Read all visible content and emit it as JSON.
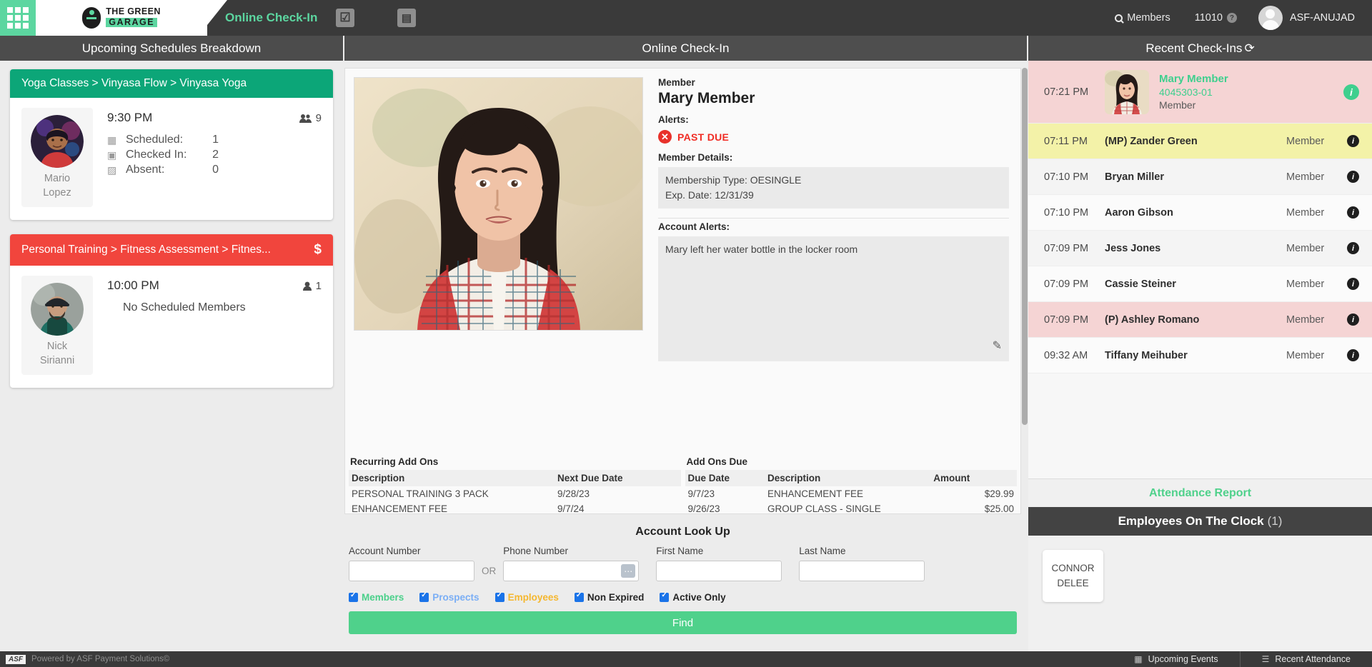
{
  "topbar": {
    "grid_icon": "grid-apps-icon",
    "logo_line1": "THE GREEN",
    "logo_line2": "GARAGE",
    "page_title": "Online Check-In",
    "check_icon": "☑",
    "card_icon": "▣",
    "members_label": "Members",
    "store_number": "11010",
    "help_icon": "?",
    "user_name": "ASF-ANUJAD"
  },
  "headers": {
    "left": "Upcoming Schedules Breakdown",
    "center": "Online Check-In",
    "right": "Recent Check-Ins",
    "refresh_icon": "⟳"
  },
  "schedules": [
    {
      "title": "Yoga Classes > Vinyasa Flow > Vinyasa Yoga",
      "color": "teal",
      "badge": "",
      "trainer_first": "Mario",
      "trainer_last": "Lopez",
      "time": "9:30 PM",
      "capacity": "9",
      "capacity_icon": "group-icon",
      "stats": [
        {
          "icon": "calendar-icon",
          "label": "Scheduled:",
          "value": "1"
        },
        {
          "icon": "calendar-check-icon",
          "label": "Checked In:",
          "value": "2"
        },
        {
          "icon": "calendar-x-icon",
          "label": "Absent:",
          "value": "0"
        }
      ],
      "empty_text": ""
    },
    {
      "title": "Personal Training > Fitness Assessment > Fitnes...",
      "color": "red",
      "badge": "$",
      "trainer_first": "Nick",
      "trainer_last": "Sirianni",
      "time": "10:00 PM",
      "capacity": "1",
      "capacity_icon": "person-icon",
      "stats": [],
      "empty_text": "No Scheduled Members"
    }
  ],
  "member": {
    "section_label": "Member",
    "name": "Mary Member",
    "alerts_label": "Alerts:",
    "alert_text": "PAST DUE",
    "alert_icon": "x-circle-icon",
    "details_label": "Member Details:",
    "membership_type": "Membership Type: OESINGLE",
    "exp_date": "Exp. Date: 12/31/39",
    "account_alerts_label": "Account Alerts:",
    "account_alert_text": "Mary left her water bottle in the locker room",
    "edit_icon": "pencil-icon"
  },
  "recurring_addons": {
    "title": "Recurring Add Ons",
    "columns": [
      "Description",
      "Next Due Date"
    ],
    "rows": [
      [
        "PERSONAL TRAINING 3 PACK",
        "9/28/23"
      ],
      [
        "ENHANCEMENT FEE",
        "9/7/24"
      ]
    ]
  },
  "addons_due": {
    "title": "Add Ons Due",
    "columns": [
      "Due Date",
      "Description",
      "Amount"
    ],
    "rows": [
      [
        "9/7/23",
        "ENHANCEMENT FEE",
        "$29.99"
      ],
      [
        "9/26/23",
        "GROUP CLASS - SINGLE",
        "$25.00"
      ]
    ]
  },
  "lookup": {
    "title": "Account Look Up",
    "account_label": "Account Number",
    "account_value": "",
    "or_text": "OR",
    "phone_label": "Phone Number",
    "phone_value": "",
    "phone_dots_icon": "⋯",
    "first_label": "First Name",
    "first_value": "",
    "last_label": "Last Name",
    "last_value": "",
    "checkboxes": [
      {
        "label": "Members",
        "checked": true,
        "color_class": "c-members"
      },
      {
        "label": "Prospects",
        "checked": true,
        "color_class": "c-prospects"
      },
      {
        "label": "Employees",
        "checked": true,
        "color_class": "c-employees"
      },
      {
        "label": "Non Expired",
        "checked": true,
        "color_class": "c-dark"
      },
      {
        "label": "Active Only",
        "checked": true,
        "color_class": "c-dark"
      }
    ],
    "find_label": "Find"
  },
  "checkins": [
    {
      "time": "07:21 PM",
      "name": "Mary Member",
      "account": "4045303-01",
      "type": "Member",
      "style": "featured",
      "has_photo": true
    },
    {
      "time": "07:11 PM",
      "name": "(MP) Zander Green",
      "account": "",
      "type": "Member",
      "style": "yellow",
      "has_photo": false
    },
    {
      "time": "07:10 PM",
      "name": "Bryan Miller",
      "account": "",
      "type": "Member",
      "style": "grey",
      "has_photo": false
    },
    {
      "time": "07:10 PM",
      "name": "Aaron Gibson",
      "account": "",
      "type": "Member",
      "style": "white",
      "has_photo": false
    },
    {
      "time": "07:09 PM",
      "name": "Jess Jones",
      "account": "",
      "type": "Member",
      "style": "grey",
      "has_photo": false
    },
    {
      "time": "07:09 PM",
      "name": "Cassie Steiner",
      "account": "",
      "type": "Member",
      "style": "white",
      "has_photo": false
    },
    {
      "time": "07:09 PM",
      "name": "(P) Ashley Romano",
      "account": "",
      "type": "Member",
      "style": "pink",
      "has_photo": false
    },
    {
      "time": "09:32 AM",
      "name": "Tiffany Meihuber",
      "account": "",
      "type": "Member",
      "style": "white",
      "has_photo": false
    }
  ],
  "attendance_report_label": "Attendance Report",
  "employees": {
    "header": "Employees On The Clock",
    "count": "(1)",
    "cards": [
      {
        "first": "CONNOR",
        "last": "DELEE"
      }
    ]
  },
  "footer": {
    "brand": "ASF",
    "text": "Powered by ASF Payment Solutions©",
    "upcoming_events": "Upcoming Events",
    "upcoming_icon": "calendar-icon",
    "recent_attendance": "Recent Attendance",
    "recent_icon": "list-icon"
  },
  "colors": {
    "accent_green": "#5cd6a0",
    "teal": "#0ca678",
    "red": "#f1453d",
    "dark": "#3a3a3a",
    "alert_red": "#f02c24"
  }
}
